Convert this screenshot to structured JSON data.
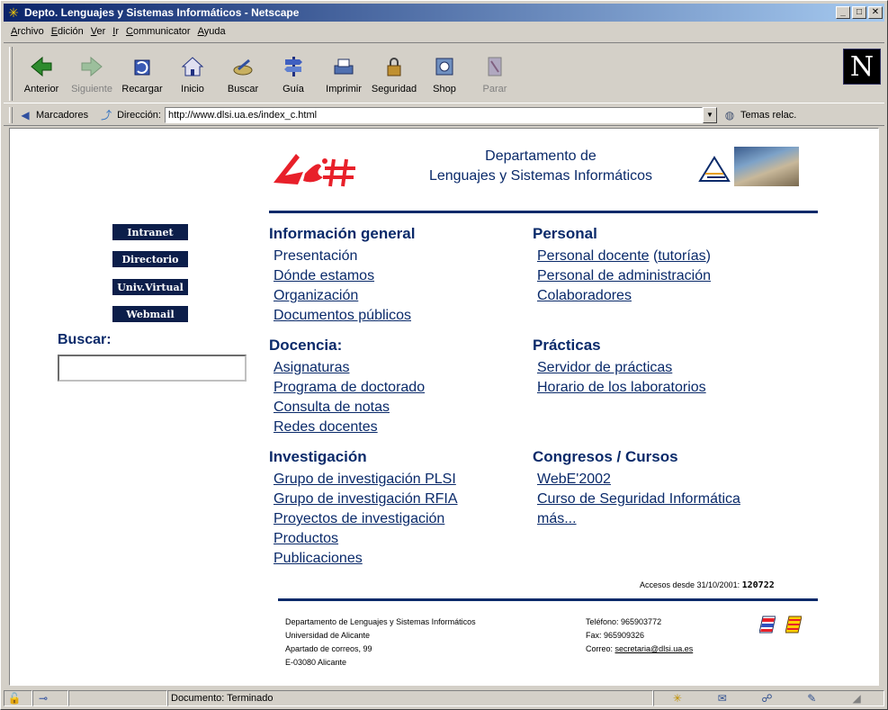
{
  "window": {
    "title": "Depto. Lenguajes y Sistemas Informáticos - Netscape",
    "minimize": "_",
    "maximize": "□",
    "close": "✕"
  },
  "menu": [
    "Archivo",
    "Edición",
    "Ver",
    "Ir",
    "Communicator",
    "Ayuda"
  ],
  "toolbar": {
    "buttons": [
      {
        "label": "Anterior",
        "icon": "back-arrow-icon",
        "enabled": true
      },
      {
        "label": "Siguiente",
        "icon": "forward-arrow-icon",
        "enabled": false
      },
      {
        "label": "Recargar",
        "icon": "reload-icon",
        "enabled": true
      },
      {
        "label": "Inicio",
        "icon": "home-icon",
        "enabled": true
      },
      {
        "label": "Buscar",
        "icon": "search-icon",
        "enabled": true
      },
      {
        "label": "Guía",
        "icon": "guide-icon",
        "enabled": true
      },
      {
        "label": "Imprimir",
        "icon": "print-icon",
        "enabled": true
      },
      {
        "label": "Seguridad",
        "icon": "lock-icon",
        "enabled": true
      },
      {
        "label": "Shop",
        "icon": "shop-icon",
        "enabled": true
      },
      {
        "label": "Parar",
        "icon": "stop-icon",
        "enabled": false
      }
    ],
    "brand_letter": "N"
  },
  "location": {
    "bookmarks_label": "Marcadores",
    "address_label": "Dirección:",
    "url": "http://www.dlsi.ua.es/index_c.html",
    "related_label": "Temas relac."
  },
  "page": {
    "dept_title_line1": "Departamento de",
    "dept_title_line2": "Lenguajes y Sistemas Informáticos",
    "side_buttons": [
      "Intranet",
      "Directorio",
      "Univ.Virtual",
      "Webmail"
    ],
    "search_label": "Buscar:",
    "search_value": "",
    "sections": {
      "info": {
        "title": "Información general",
        "links": [
          "Presentación",
          "Dónde estamos",
          "Organización",
          "Documentos públicos"
        ]
      },
      "personal": {
        "title": "Personal",
        "links": [
          "Personal docente",
          "Personal de administración",
          "Colaboradores"
        ],
        "tutorias": "tutorías"
      },
      "docencia": {
        "title": "Docencia:",
        "links": [
          "Asignaturas",
          "Programa de doctorado",
          "Consulta de notas",
          "Redes docentes"
        ]
      },
      "practicas": {
        "title": "Prácticas",
        "links": [
          "Servidor de prácticas",
          "Horario de los laboratorios"
        ]
      },
      "investigacion": {
        "title": "Investigación",
        "links": [
          "Grupo de investigación PLSI",
          "Grupo de investigación RFIA",
          "Proyectos de investigación",
          "Productos",
          "Publicaciones"
        ]
      },
      "congresos": {
        "title": "Congresos / Cursos",
        "links": [
          "WebE'2002",
          "Curso de Seguridad Informática",
          "más..."
        ]
      }
    },
    "accesos_label": "Accesos desde 31/10/2001:",
    "accesos_count": "120722",
    "footer_left": [
      "Departamento de Lenguajes y Sistemas Informáticos",
      "Universidad de Alicante",
      "Apartado de correos, 99",
      "E-03080 Alicante"
    ],
    "footer_phone": "Teléfono: 965903772",
    "footer_fax": "Fax: 965909326",
    "footer_mail_label": "Correo:",
    "footer_mail": "secretaria@dlsi.ua.es",
    "colors": {
      "navy": "#0a2a6a",
      "logo_red": "#e8202a"
    }
  },
  "status": {
    "text": "Documento: Terminado"
  }
}
